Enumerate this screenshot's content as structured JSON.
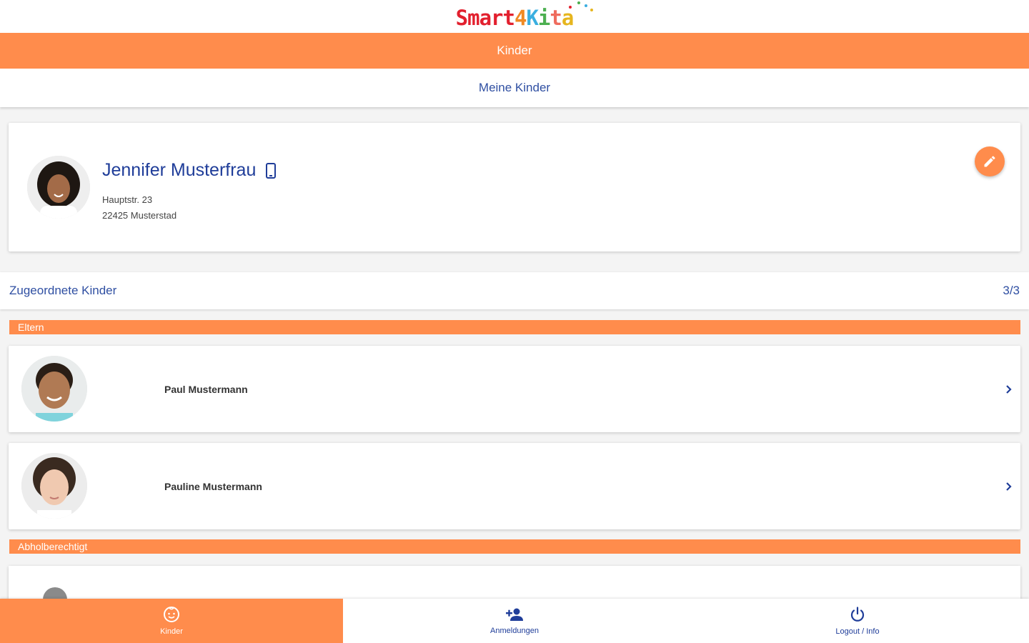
{
  "app": {
    "logo": {
      "smart": "Smart",
      "four": "4",
      "k": "K",
      "i": "i",
      "t": "t",
      "a": "a"
    },
    "title": "Kinder",
    "subtitle": "Meine Kinder"
  },
  "profile": {
    "name": "Jennifer Musterfrau",
    "street": "Hauptstr. 23",
    "city": "22425 Musterstad"
  },
  "assigned": {
    "label": "Zugeordnete Kinder",
    "count": "3/3"
  },
  "sections": {
    "parents": "Eltern",
    "pickup": "Abholberechtigt"
  },
  "children": [
    {
      "name": "Paul Mustermann"
    },
    {
      "name": "Pauline Mustermann"
    }
  ],
  "nav": [
    {
      "label": "Kinder",
      "icon": "child-care-icon",
      "active": true
    },
    {
      "label": "Anmeldungen",
      "icon": "person-add-icon",
      "active": false
    },
    {
      "label": "Logout / Info",
      "icon": "power-icon",
      "active": false
    }
  ],
  "colors": {
    "accent": "#ff8c4c",
    "primary_text": "#1f3d99"
  }
}
